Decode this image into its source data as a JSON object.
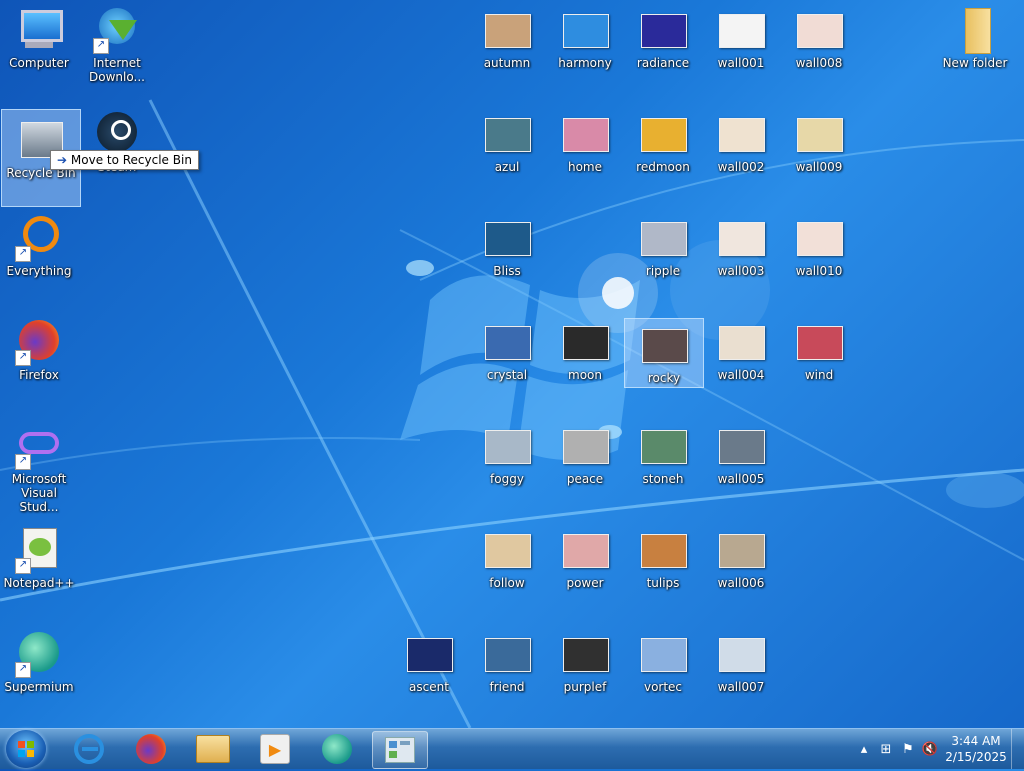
{
  "desktop_icons": [
    {
      "label": "Computer"
    },
    {
      "label": "Internet Downlo..."
    },
    {
      "label": "Recycle Bin"
    },
    {
      "label": "Steam"
    },
    {
      "label": "Everything"
    },
    {
      "label": "Firefox"
    },
    {
      "label": "Microsoft Visual Stud..."
    },
    {
      "label": "Notepad++"
    },
    {
      "label": "Supermium"
    },
    {
      "label": "New folder"
    }
  ],
  "image_files": [
    {
      "label": "autumn",
      "color": "#c9a27a"
    },
    {
      "label": "harmony",
      "color": "#2e8de0"
    },
    {
      "label": "radiance",
      "color": "#2a2a9a"
    },
    {
      "label": "wall001",
      "color": "#f4f4f4"
    },
    {
      "label": "wall008",
      "color": "#f1dcd5"
    },
    {
      "label": "azul",
      "color": "#4a7a8a"
    },
    {
      "label": "home",
      "color": "#d98aa8"
    },
    {
      "label": "redmoon",
      "color": "#e8b030"
    },
    {
      "label": "wall002",
      "color": "#efe2d0"
    },
    {
      "label": "wall009",
      "color": "#e7d8a8"
    },
    {
      "label": "Bliss",
      "color": "#1e5a8a"
    },
    {
      "label": "ripple",
      "color": "#b0b8c8"
    },
    {
      "label": "wall003",
      "color": "#f0e6de"
    },
    {
      "label": "wall010",
      "color": "#f2e0d8"
    },
    {
      "label": "crystal",
      "color": "#3a6ab0"
    },
    {
      "label": "moon",
      "color": "#2a2a2a"
    },
    {
      "label": "rocky",
      "color": "#5a4a4a"
    },
    {
      "label": "wall004",
      "color": "#eadfd0"
    },
    {
      "label": "wind",
      "color": "#c84a5a"
    },
    {
      "label": "foggy",
      "color": "#a8b8c8"
    },
    {
      "label": "peace",
      "color": "#b0b0b0"
    },
    {
      "label": "stoneh",
      "color": "#5a8a6a"
    },
    {
      "label": "wall005",
      "color": "#6a7a8a"
    },
    {
      "label": "follow",
      "color": "#e0c8a0"
    },
    {
      "label": "power",
      "color": "#e0a8a8"
    },
    {
      "label": "tulips",
      "color": "#c88040"
    },
    {
      "label": "wall006",
      "color": "#b8a890"
    },
    {
      "label": "ascent",
      "color": "#1a2a6a"
    },
    {
      "label": "friend",
      "color": "#3a6a9a"
    },
    {
      "label": "purplef",
      "color": "#303030"
    },
    {
      "label": "vortec",
      "color": "#8ab0e0"
    },
    {
      "label": "wall007",
      "color": "#d0dce8"
    }
  ],
  "tooltip": {
    "text": "Move to Recycle Bin",
    "arrow": "➔"
  },
  "taskbar": {
    "pinned": [
      {
        "name": "internet-explorer-icon"
      },
      {
        "name": "firefox-icon"
      },
      {
        "name": "file-explorer-icon"
      },
      {
        "name": "media-player-icon"
      },
      {
        "name": "supermium-icon"
      },
      {
        "name": "control-panel-icon"
      }
    ]
  },
  "clock": {
    "time": "3:44 AM",
    "date": "2/15/2025"
  },
  "colors": {
    "desktop": "#1a78d8",
    "taskbar": "#2d6db0"
  }
}
